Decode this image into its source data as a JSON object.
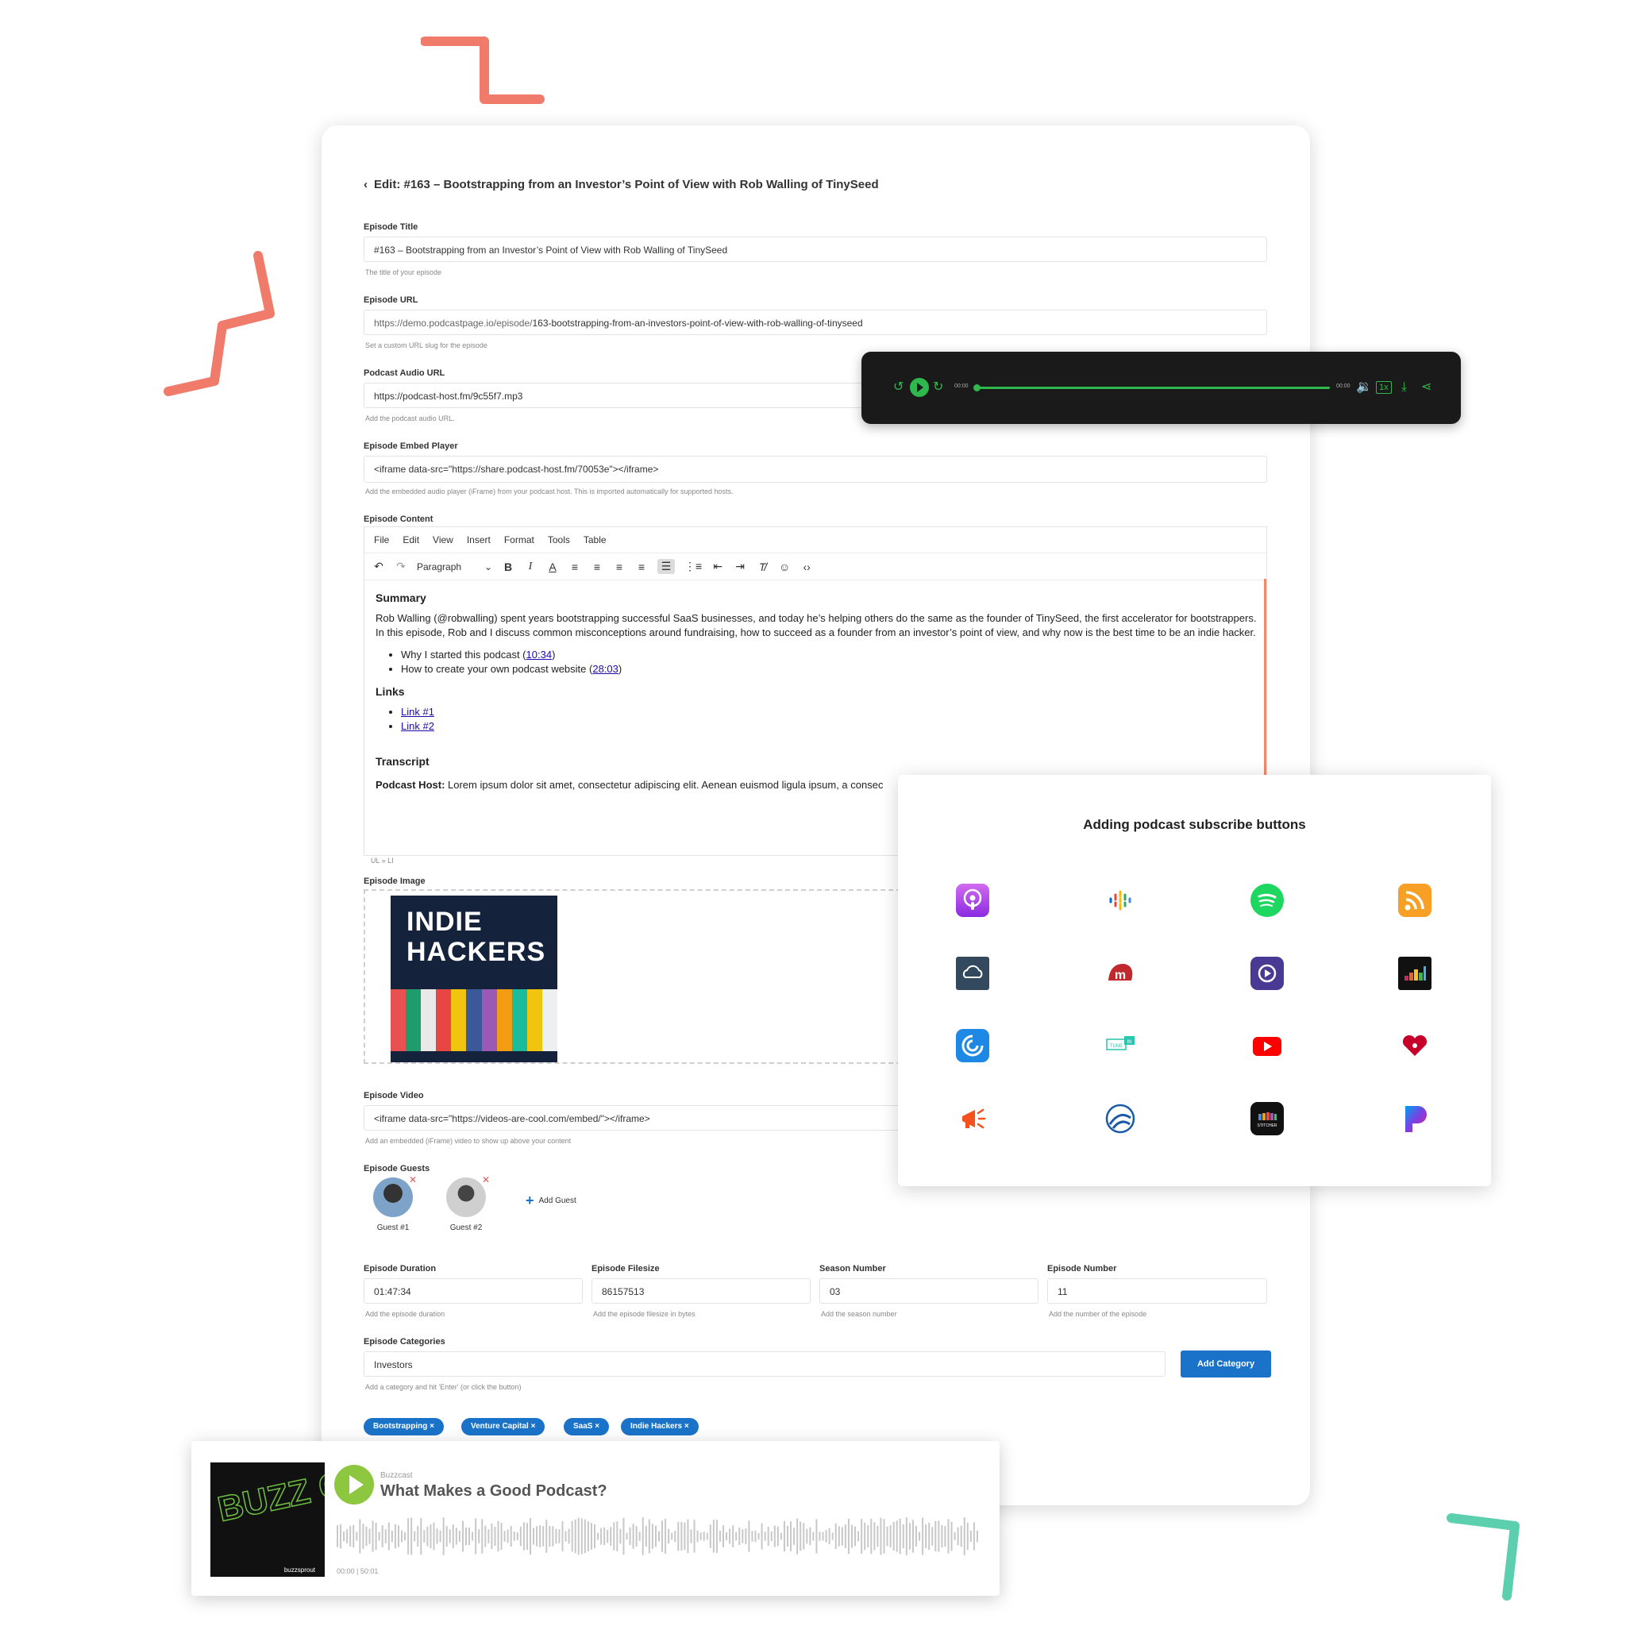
{
  "editor": {
    "header": "Edit: #163 – Bootstrapping from an Investor’s Point of View with Rob Walling of TinySeed",
    "fields": {
      "title": {
        "label": "Episode Title",
        "value": "#163 – Bootstrapping from an Investor’s Point of View with Rob Walling of TinySeed",
        "help": "The title of your episode"
      },
      "url": {
        "label": "Episode URL",
        "prefix": "https://demo.podcastpage.io/episode/",
        "value": "163-bootstrapping-from-an-investors-point-of-view-with-rob-walling-of-tinyseed",
        "help": "Set a custom URL slug for the episode"
      },
      "audio": {
        "label": "Podcast Audio URL",
        "value": "https://podcast-host.fm/9c55f7.mp3",
        "help": "Add the podcast audio URL."
      },
      "embed": {
        "label": "Episode Embed Player",
        "value": "<iframe data-src=\"https://share.podcast-host.fm/70053e\"></iframe>",
        "help": "Add the embedded audio player (iFrame) from your podcast host. This is imported automatically for supported hosts."
      },
      "content": {
        "label": "Episode Content"
      },
      "image": {
        "label": "Episode Image"
      },
      "video": {
        "label": "Episode Video",
        "value": "<iframe data-src=\"https://videos-are-cool.com/embed/\"></iframe>",
        "help": "Add an embedded (iFrame) video to show up above your content"
      },
      "guests": {
        "label": "Episode Guests"
      },
      "duration": {
        "label": "Episode Duration",
        "value": "01:47:34",
        "help": "Add the episode duration"
      },
      "filesize": {
        "label": "Episode Filesize",
        "value": "86157513",
        "help": "Add the episode filesize in bytes"
      },
      "season": {
        "label": "Season Number",
        "value": "03",
        "help": "Add the season number"
      },
      "episode": {
        "label": "Episode Number",
        "value": "11",
        "help": "Add the number of the episode"
      },
      "categories": {
        "label": "Episode Categories",
        "value": "Investors",
        "help": "Add a category and hit 'Enter' (or click the button)",
        "button": "Add Category"
      }
    },
    "menubar": [
      "File",
      "Edit",
      "View",
      "Insert",
      "Format",
      "Tools",
      "Table"
    ],
    "toolbar": {
      "block": "Paragraph"
    },
    "body": {
      "h_summary": "Summary",
      "summary": "Rob Walling (@robwalling) spent years bootstrapping successful SaaS businesses, and today he’s helping others do the same as the founder of TinySeed, the first accelerator for bootstrappers. In this episode, Rob and I discuss common misconceptions around fundraising, how to succeed as a founder from an investor’s point of view, and why now is the best time to be an indie hacker.",
      "b1": "Why I started this podcast (",
      "b1_link": "10:34",
      "b1_end": ")",
      "b2": "How to create your own podcast website (",
      "b2_link": "28:03",
      "b2_end": ")",
      "h_links": "Links",
      "link1": "Link #1",
      "link2": "Link #2",
      "h_transcript": "Transcript",
      "host_label": "Podcast Host:",
      "host_text": " Lorem ipsum dolor sit amet, consectetur adipiscing elit. Aenean euismod ligula ipsum, a consec",
      "crumb": "UL » LI"
    },
    "image": {
      "line1": "INDIE",
      "line2": "HACKERS"
    },
    "guests": [
      "Guest #1",
      "Guest #2"
    ],
    "add_guest": "Add Guest",
    "tags": [
      "Bootstrapping",
      "Venture Capital",
      "SaaS",
      "Indie Hackers"
    ]
  },
  "player": {
    "time_current": "00:00",
    "time_total": "00:00",
    "accent": "#2fb84d"
  },
  "subscribe": {
    "title": "Adding podcast subscribe buttons",
    "icons": [
      "apple-podcasts-icon",
      "google-podcasts-icon",
      "spotify-icon",
      "rss-icon",
      "overcast-icon",
      "castro-icon",
      "castbox-icon",
      "deezer-icon",
      "pocket-casts-icon",
      "tunein-icon",
      "youtube-icon",
      "iheartradio-icon",
      "podcast-addict-icon",
      "breaker-icon",
      "stitcher-icon",
      "pandora-icon"
    ],
    "tunein_text": "TUNE IN",
    "stitcher_text": "STITCHER"
  },
  "buzzcast": {
    "show": "Buzzcast",
    "title": "What Makes a Good Podcast?",
    "time": "00:00 | 50:01",
    "art_text": "BUZZ CAST",
    "brand": "buzzsprout"
  },
  "colors": {
    "primary": "#1a73c8",
    "coral": "#f07b6b",
    "mint": "#5ccfae",
    "buzz_green": "#8dc63f"
  }
}
